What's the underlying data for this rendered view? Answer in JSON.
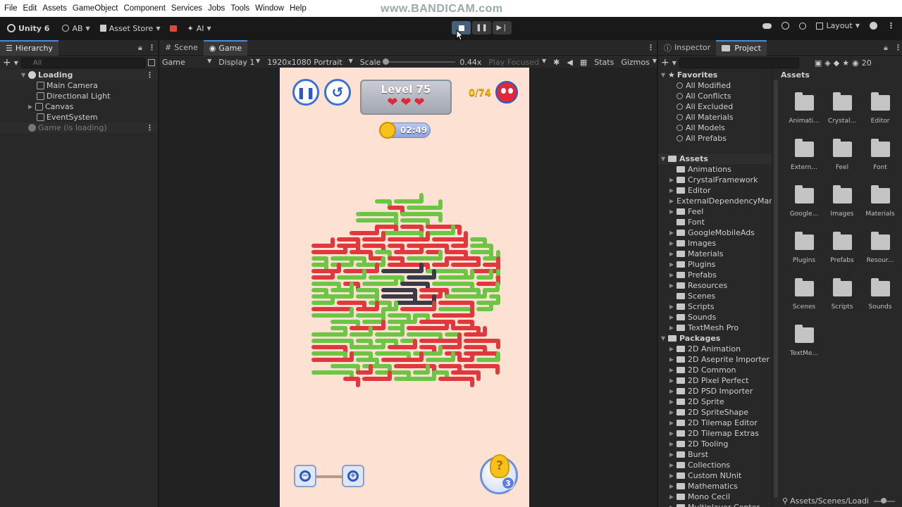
{
  "menu": [
    "File",
    "Edit",
    "Assets",
    "GameObject",
    "Component",
    "Services",
    "Jobs",
    "Tools",
    "Window",
    "Help"
  ],
  "watermark": "www.BANDICAM.com",
  "toolbar": {
    "unity": "Unity 6",
    "account": "AB",
    "asset_store": "Asset Store",
    "ai": "AI",
    "layout": "Layout"
  },
  "hierarchy": {
    "tab": "Hierarchy",
    "search_placeholder": "All",
    "scene": "Loading",
    "items": [
      "Main Camera",
      "Directional Light",
      "Canvas",
      "EventSystem"
    ],
    "loading_scene": "Game (is loading)"
  },
  "center_tabs": {
    "scene": "Scene",
    "game": "Game"
  },
  "gamebar": {
    "mode": "Game",
    "display": "Display 1",
    "resolution": "1920x1080 Portrait",
    "scale_label": "Scale",
    "scale_value": "0.44x",
    "play_focused": "Play Focused",
    "stats": "Stats",
    "gizmos": "Gizmos"
  },
  "game": {
    "level": "Level 75",
    "hearts": 3,
    "progress": "0/74",
    "timer": "02:49",
    "hint_count": "3",
    "colors": {
      "green": "#6cc644",
      "red": "#e0383c",
      "dark": "#3a3a48",
      "bg": "#fde2d4"
    }
  },
  "right_tabs": {
    "inspector": "Inspector",
    "project": "Project",
    "count": "20"
  },
  "project": {
    "favorites_title": "Favorites",
    "favorites": [
      "All Modified",
      "All Conflicts",
      "All Excluded",
      "All Materials",
      "All Models",
      "All Prefabs"
    ],
    "assets_title": "Assets",
    "assets": [
      "Animations",
      "CrystalFramework",
      "Editor",
      "ExternalDependencyMana",
      "Feel",
      "Font",
      "GoogleMobileAds",
      "Images",
      "Materials",
      "Plugins",
      "Prefabs",
      "Resources",
      "Scenes",
      "Scripts",
      "Sounds",
      "TextMesh Pro"
    ],
    "packages_title": "Packages",
    "packages": [
      "2D Animation",
      "2D Aseprite Importer",
      "2D Common",
      "2D Pixel Perfect",
      "2D PSD Importer",
      "2D Sprite",
      "2D SpriteShape",
      "2D Tilemap Editor",
      "2D Tilemap Extras",
      "2D Tooling",
      "Burst",
      "Collections",
      "Custom NUnit",
      "Mathematics",
      "Mono Cecil",
      "Multiplayer Center"
    ],
    "grid_title": "Assets",
    "grid": [
      "Animati...",
      "Crystal...",
      "Editor",
      "Extern...",
      "Feel",
      "Font",
      "Google...",
      "Images",
      "Materials",
      "Plugins",
      "Prefabs",
      "Resour...",
      "Scenes",
      "Scripts",
      "Sounds",
      "TextMe..."
    ],
    "path": "Assets/Scenes/Loadi"
  }
}
